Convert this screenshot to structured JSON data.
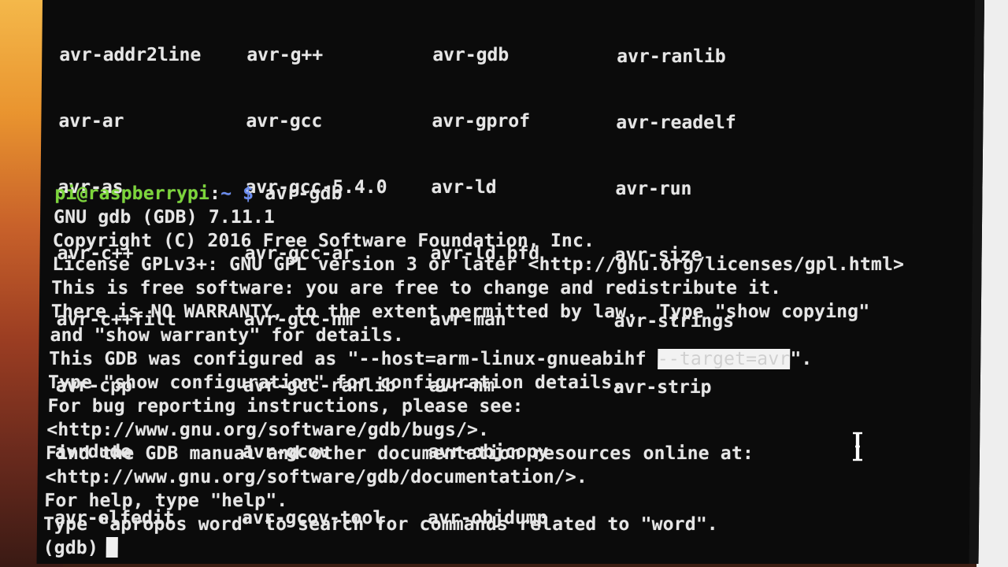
{
  "listing": {
    "col1": [
      "avr-addr2line",
      "avr-ar",
      "avr-as",
      "avr-c++",
      "avr-c++filt",
      "avr-cpp",
      "avrdude",
      "avr-elfedit"
    ],
    "col2": [
      "avr-g++",
      "avr-gcc",
      "avr-gcc-5.4.0",
      "avr-gcc-ar",
      "avr-gcc-nm",
      "avr-gcc-ranlib",
      "avr-gcov",
      "avr-gcov-tool"
    ],
    "col3": [
      "avr-gdb",
      "avr-gprof",
      "avr-ld",
      "avr-ld.bfd",
      "avr-man",
      "avr-nm",
      "avr-objcopy",
      "avr-objdump"
    ],
    "col4": [
      "avr-ranlib",
      "avr-readelf",
      "avr-run",
      "avr-size",
      "avr-strings",
      "avr-strip"
    ]
  },
  "prompt": {
    "user_host": "pi@raspberrypi",
    "sep": ":",
    "path": "~ $",
    "command": " avr-gdb"
  },
  "output": {
    "l1": "GNU gdb (GDB) 7.11.1",
    "l2": "Copyright (C) 2016 Free Software Foundation, Inc.",
    "l3": "License GPLv3+: GNU GPL version 3 or later <http://gnu.org/licenses/gpl.html>",
    "l4": "This is free software: you are free to change and redistribute it.",
    "l5": "There is NO WARRANTY, to the extent permitted by law.  Type \"show copying\"",
    "l6": "and \"show warranty\" for details.",
    "l7a": "This GDB was configured as \"--host=arm-linux-gnueabihf ",
    "l7b": "--target=avr",
    "l7c": "\".",
    "l8": "Type \"show configuration\" for configuration details.",
    "l9": "For bug reporting instructions, please see:",
    "l10": "<http://www.gnu.org/software/gdb/bugs/>.",
    "l11": "Find the GDB manual and other documentation resources online at:",
    "l12": "<http://www.gnu.org/software/gdb/documentation/>.",
    "l13": "For help, type \"help\".",
    "l14": "Type \"apropos word\" to search for commands related to \"word\".",
    "gdb_prompt": "(gdb)"
  },
  "colors": {
    "terminal_bg": "#0b0b0b",
    "text": "#e6e6e6",
    "user_host": "#7cd63a",
    "path": "#6a8cf0"
  }
}
